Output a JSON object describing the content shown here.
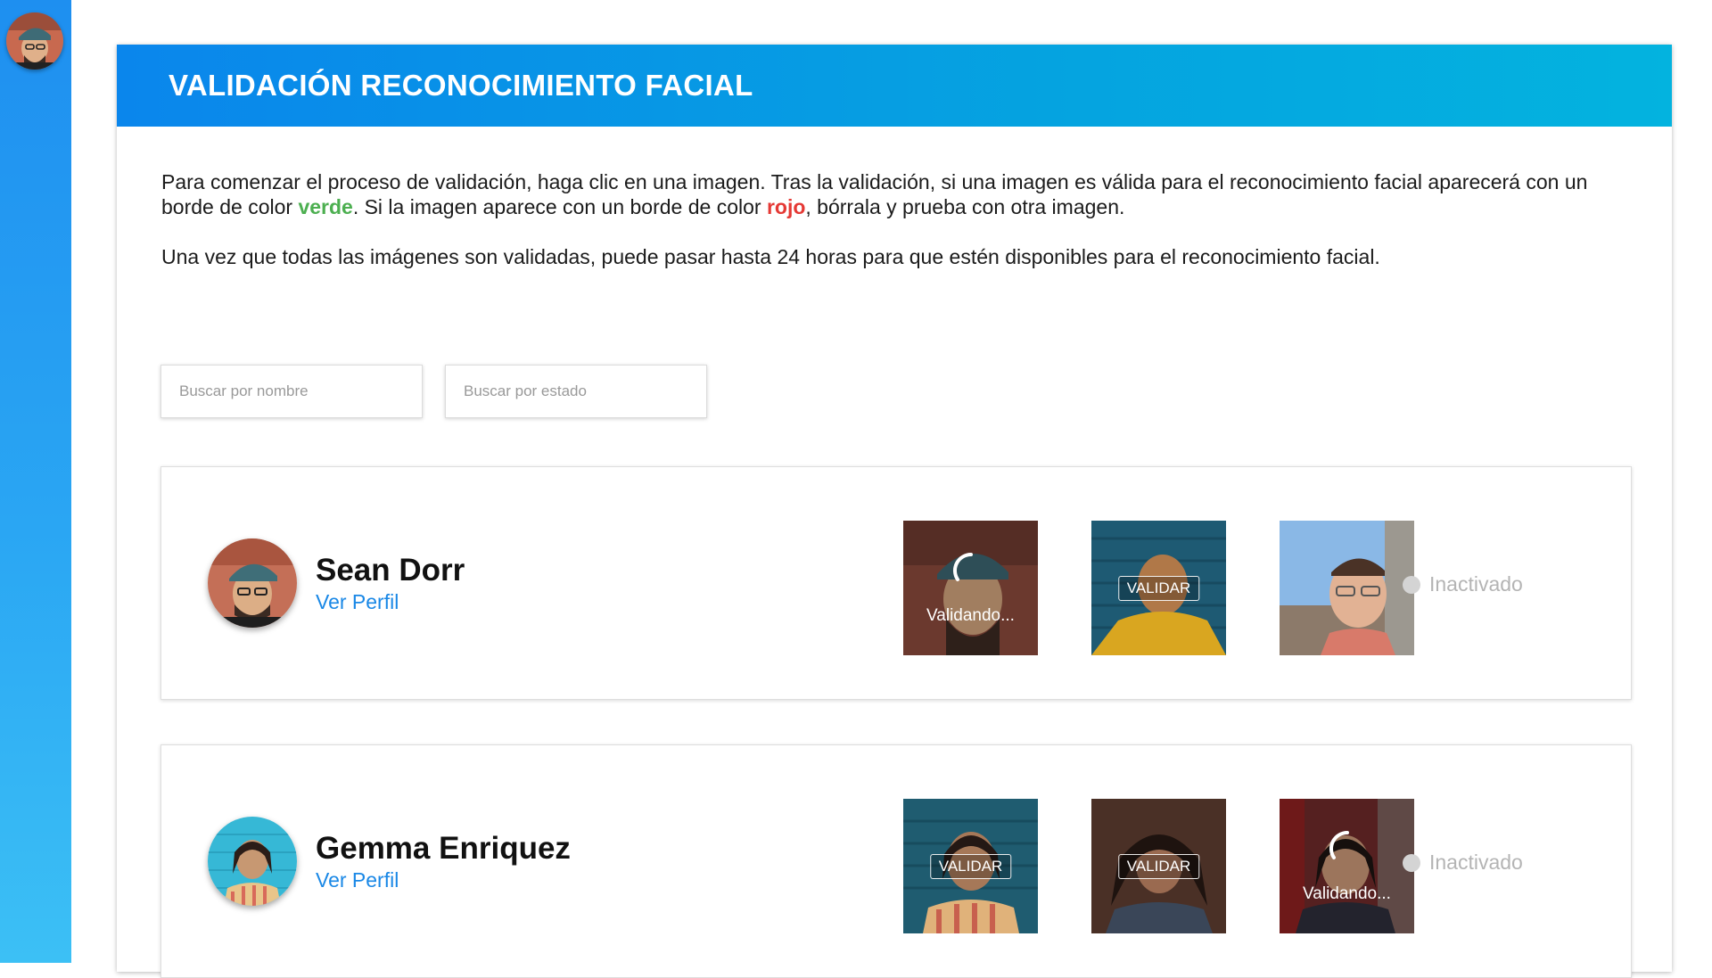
{
  "card": {
    "title": "VALIDACIÓN RECONOCIMIENTO FACIAL"
  },
  "intro": {
    "p1_before_green": "Para comenzar el proceso de validación, haga clic en una imagen. Tras la validación, si una imagen es válida para el reconocimiento facial aparecerá con un borde de color ",
    "green_word": "verde",
    "p1_between": ". Si la imagen aparece con un borde de color ",
    "red_word": "rojo",
    "p1_after_red": ", bórrala y prueba con otra imagen.",
    "p2": "Una vez que todas las imágenes son validadas, puede pasar hasta 24 horas para que estén disponibles para el reconocimiento facial.",
    "green_color": "#4caf50",
    "red_color": "#e53935"
  },
  "search": {
    "name_placeholder": "Buscar por nombre",
    "state_placeholder": "Buscar por estado"
  },
  "users": [
    {
      "name": "Sean Dorr",
      "profile_link": "Ver Perfil",
      "status": "Inactivado",
      "images": [
        {
          "state": "validating",
          "label": "Validando..."
        },
        {
          "state": "pending",
          "label": "VALIDAR"
        },
        {
          "state": "none",
          "label": ""
        }
      ]
    },
    {
      "name": "Gemma Enriquez",
      "profile_link": "Ver Perfil",
      "status": "Inactivado",
      "images": [
        {
          "state": "pending",
          "label": "VALIDAR"
        },
        {
          "state": "pending",
          "label": "VALIDAR"
        },
        {
          "state": "validating",
          "label": "Validando..."
        }
      ]
    }
  ],
  "colors": {
    "accent": "#0a86ec",
    "link": "#1a88e6",
    "status_inactive": "#b4b4b4"
  },
  "icons": {
    "sidebar_avatar": "user-avatar-icon",
    "status": "status-dot-icon",
    "spinner": "loading-spinner-icon"
  }
}
